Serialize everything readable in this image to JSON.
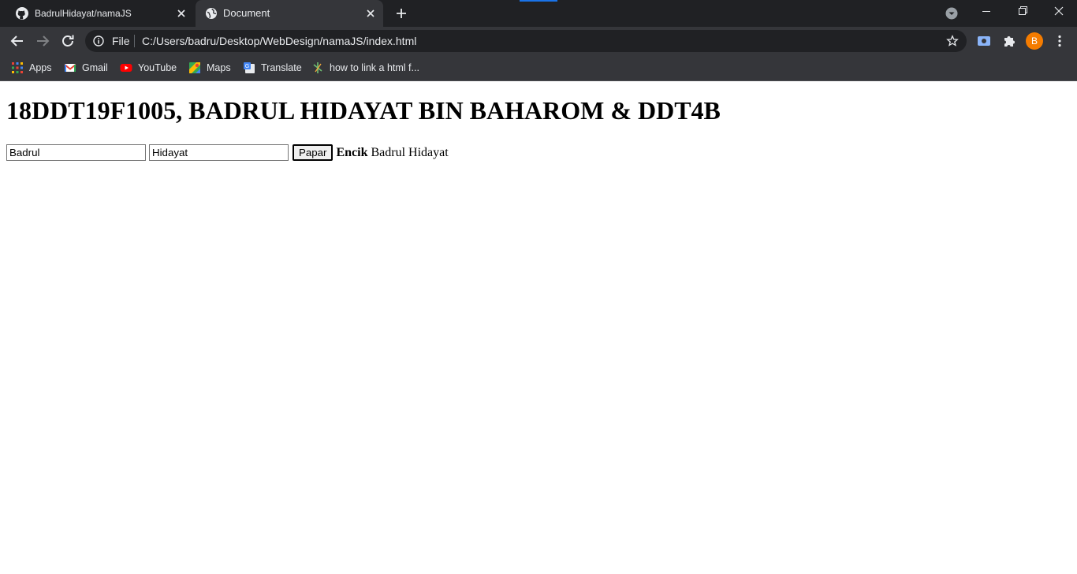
{
  "browser": {
    "tabs": [
      {
        "title": "BadrulHidayat/namaJS",
        "favicon": "github-icon",
        "active": false
      },
      {
        "title": "Document",
        "favicon": "globe-icon",
        "active": true
      }
    ],
    "omnibox": {
      "scheme_label": "File",
      "url": "C:/Users/badru/Desktop/WebDesign/namaJS/index.html"
    },
    "profile_initial": "B",
    "profile_color": "#f57c00",
    "accent_color": "#1a73e8",
    "bookmarks": [
      {
        "label": "Apps",
        "icon": "apps-grid-icon"
      },
      {
        "label": "Gmail",
        "icon": "gmail-icon"
      },
      {
        "label": "YouTube",
        "icon": "youtube-icon"
      },
      {
        "label": "Maps",
        "icon": "maps-icon"
      },
      {
        "label": "Translate",
        "icon": "translate-icon"
      },
      {
        "label": "how to link a html f...",
        "icon": "bookmark-favicon-icon"
      }
    ]
  },
  "page": {
    "heading": "18DDT19F1005, BADRUL HIDAYAT BIN BAHAROM & DDT4B",
    "first_name_value": "Badrul",
    "last_name_value": "Hidayat",
    "show_button_label": "Papar",
    "output_prefix": "Encik",
    "output_name": "Badrul Hidayat"
  }
}
